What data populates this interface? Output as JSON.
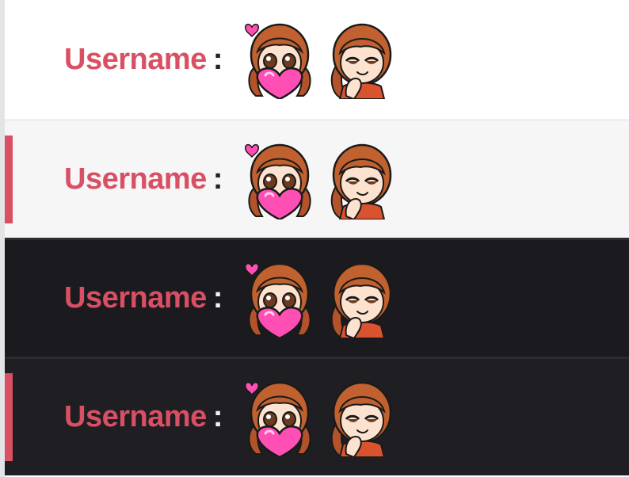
{
  "rows": [
    {
      "theme": "light",
      "highlighted": false,
      "username": "Username",
      "separator": ":",
      "emotes": [
        "heart-hug-emote",
        "smug-blush-emote"
      ]
    },
    {
      "theme": "light-alt",
      "highlighted": true,
      "username": "Username",
      "separator": ":",
      "emotes": [
        "heart-hug-emote",
        "smug-blush-emote"
      ]
    },
    {
      "theme": "dark",
      "highlighted": false,
      "username": "Username",
      "separator": ":",
      "emotes": [
        "heart-hug-emote",
        "smug-blush-emote"
      ]
    },
    {
      "theme": "dark-alt",
      "highlighted": true,
      "username": "Username",
      "separator": ":",
      "emotes": [
        "heart-hug-emote",
        "smug-blush-emote"
      ]
    }
  ],
  "colors": {
    "username": "#d94f63",
    "accent_bar": "#d94f63",
    "hair": "#b4532a",
    "heart": "#ff4fb4"
  }
}
